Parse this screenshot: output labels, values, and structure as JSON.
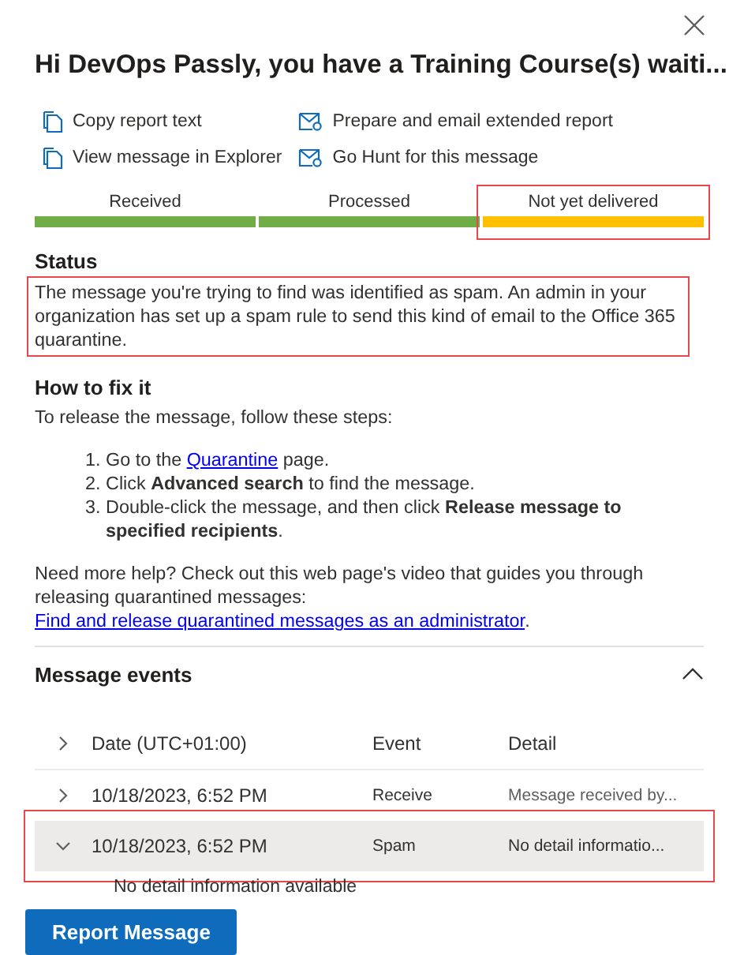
{
  "title": "Hi DevOps Passly, you have a Training Course(s) waiti...",
  "actions": [
    {
      "kind": "copy",
      "label": "Copy report text"
    },
    {
      "kind": "mail",
      "label": "Prepare and email extended report"
    },
    {
      "kind": "copy",
      "label": "View message in Explorer"
    },
    {
      "kind": "mail",
      "label": "Go Hunt for this message"
    }
  ],
  "stages": [
    {
      "label": "Received",
      "complete": true,
      "highlighted": false
    },
    {
      "label": "Processed",
      "complete": true,
      "highlighted": false
    },
    {
      "label": "Not yet delivered",
      "complete": false,
      "highlighted": true
    }
  ],
  "status": {
    "heading": "Status",
    "text": "The message you're trying to find was identified as spam. An admin in your organization has set up a spam rule to send this kind of email to the Office 365 quarantine.",
    "highlighted": true
  },
  "fix": {
    "heading": "How to fix it",
    "intro": "To release the message, follow these steps:",
    "steps": [
      {
        "number": "1.",
        "before": "Go to the ",
        "link": "Quarantine",
        "after": " page."
      },
      {
        "number": "2.",
        "text": "Click **Advanced search** to find the message."
      },
      {
        "number": "3.",
        "text": "Double-click the message, and then click **Release message to specified recipients**."
      }
    ],
    "help": "Need more help? Check out this web page's video that guides you through releasing quarantined messages: ",
    "help_link": "Find and release quarantined messages as an administrator",
    "help_end": "."
  },
  "events": {
    "heading": "Message events",
    "expanded": true,
    "columns": [
      "Date (UTC+01:00)",
      "Event",
      "Detail"
    ],
    "rows": [
      {
        "date": "10/18/2023, 6:52 PM",
        "event": "Receive",
        "detail": "Message received by...",
        "expanded": false,
        "selected": false,
        "highlighted": false
      },
      {
        "date": "10/18/2023, 6:52 PM",
        "event": "Spam",
        "detail": "No detail informatio...",
        "expanded": true,
        "selected": true,
        "highlighted": true,
        "more": "No detail information available"
      }
    ]
  },
  "button": "Report Message"
}
